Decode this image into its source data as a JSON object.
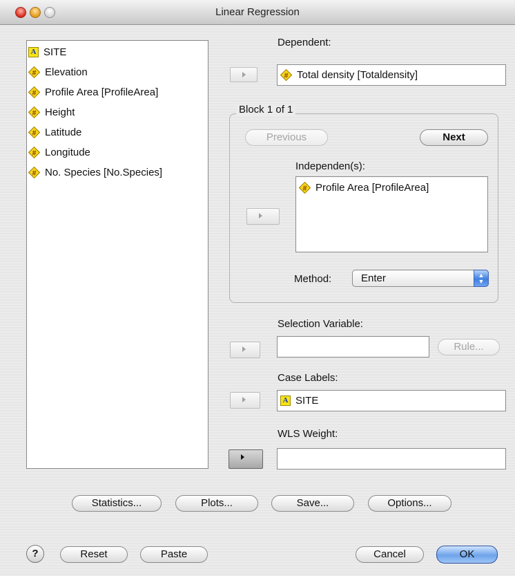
{
  "window": {
    "title": "Linear Regression"
  },
  "variables": [
    {
      "label": "SITE",
      "type": "nominal"
    },
    {
      "label": "Elevation",
      "type": "scale"
    },
    {
      "label": "Profile Area [ProfileArea]",
      "type": "scale"
    },
    {
      "label": "Height",
      "type": "scale"
    },
    {
      "label": "Latitude",
      "type": "scale"
    },
    {
      "label": "Longitude",
      "type": "scale"
    },
    {
      "label": "No. Species [No.Species]",
      "type": "scale"
    }
  ],
  "nominal_icon_glyph": "A",
  "dependent": {
    "label": "Dependent:",
    "value": "Total density [Totaldensity]"
  },
  "block": {
    "legend": "Block 1 of 1",
    "previous_label": "Previous",
    "next_label": "Next",
    "independents_label": "Independen(s):",
    "independents": [
      "Profile Area [ProfileArea]"
    ],
    "method_label": "Method:",
    "method_value": "Enter"
  },
  "selection": {
    "label": "Selection Variable:",
    "value": "",
    "rule_label": "Rule..."
  },
  "case_labels": {
    "label": "Case Labels:",
    "value": "SITE"
  },
  "wls": {
    "label": "WLS Weight:",
    "value": ""
  },
  "buttons": {
    "statistics": "Statistics...",
    "plots": "Plots...",
    "save": "Save...",
    "options": "Options...",
    "help": "?",
    "reset": "Reset",
    "paste": "Paste",
    "cancel": "Cancel",
    "ok": "OK"
  },
  "colors": {
    "scale_icon": "#f6d31a",
    "nominal_icon": "#f8e414",
    "default_button": "#6ea4ea"
  }
}
